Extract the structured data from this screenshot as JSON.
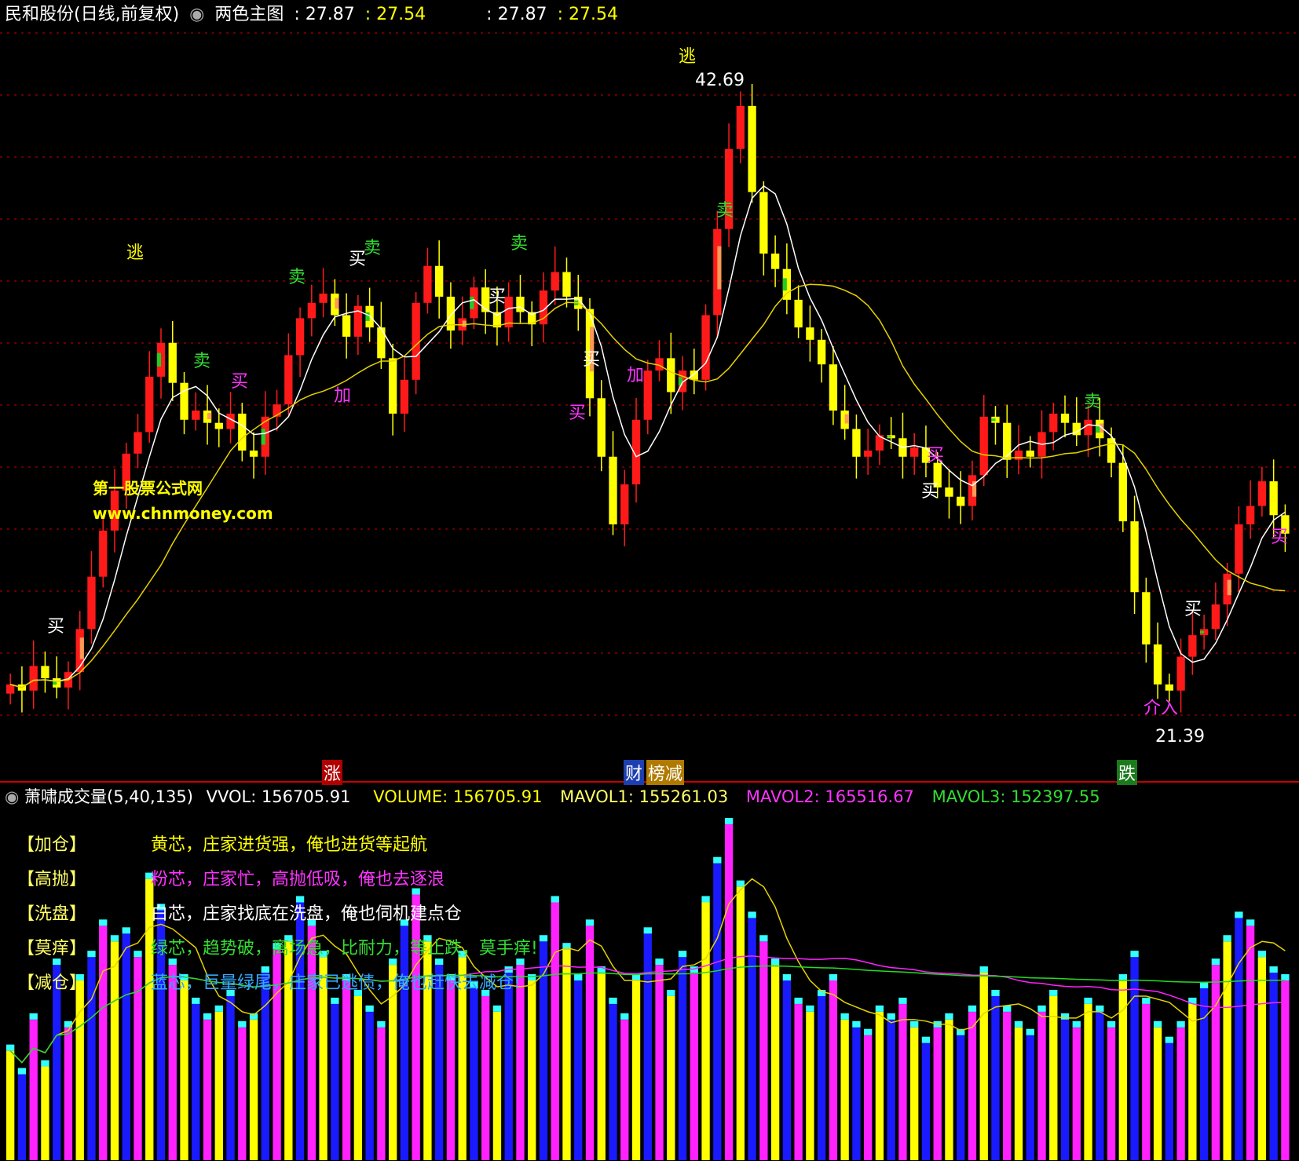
{
  "header": {
    "title": "民和股份(日线,前复权)",
    "indicator": "两色主图",
    "v1": ": 27.87",
    "v2": ": 27.54",
    "v3": ": 27.87",
    "v4": ": 27.54"
  },
  "watermark": {
    "line1": "第一股票公式网",
    "line2": "www.chnmoney.com"
  },
  "markers": {
    "high": "42.69",
    "low": "21.39",
    "flee": "逃",
    "buy": "买",
    "sell": "卖",
    "add": "加",
    "intervene": "介入",
    "mid_a": "涨",
    "mid_b": "财",
    "mid_c": "榜减",
    "mid_d": "跌"
  },
  "volume_header": {
    "name": "萧啸成交量(5,40,135)",
    "vvol": "VVOL: 156705.91",
    "volume": "VOLUME: 156705.91",
    "mavol1": "MAVOL1: 155261.03",
    "mavol2": "MAVOL2: 165516.67",
    "mavol3": "MAVOL3: 152397.55"
  },
  "legend": [
    {
      "key": "【加仓】",
      "text": "黄芯，庄家进货强，俺也进货等起航",
      "color": "#ffff00"
    },
    {
      "key": "【高抛】",
      "text": "粉芯，庄家忙，高抛低吸，俺也去逐浪",
      "color": "#ff33ff"
    },
    {
      "key": "【洗盘】",
      "text": "白芯，庄家找底在洗盘，俺也伺机建点仓",
      "color": "#ffffff"
    },
    {
      "key": "【莫痒】",
      "text": "绿芯，趋势破，离场急，比耐力，等止跌，莫手痒!",
      "color": "#33dd33"
    },
    {
      "key": "【减仓】",
      "text": "蓝芯，巨量绿尾，庄家已逃债，俺也赶快去减仓!",
      "color": "#33aaff"
    }
  ],
  "colors": {
    "up": "#ff1a1a",
    "down": "#ffff00",
    "ma_white": "#ffffff",
    "ma_yellow": "#e6d200",
    "grid": "#c80000",
    "vol_blue": "#1a1aff",
    "vol_pink": "#ff22ff",
    "vol_cyan": "#33ffff",
    "mavol_green": "#22dd22"
  },
  "chart_data": {
    "type": "candlestick",
    "price_high": 42.69,
    "price_low": 21.39,
    "close_series": [
      23.0,
      22.8,
      23.6,
      23.2,
      22.9,
      23.4,
      24.8,
      26.5,
      28.0,
      29.3,
      30.5,
      31.2,
      33.0,
      34.1,
      32.8,
      31.6,
      31.9,
      31.5,
      31.3,
      31.8,
      30.6,
      30.4,
      31.7,
      32.1,
      33.7,
      34.9,
      35.4,
      35.7,
      35.0,
      34.3,
      35.3,
      34.6,
      33.6,
      31.8,
      32.9,
      35.4,
      36.6,
      35.6,
      34.5,
      34.9,
      35.9,
      35.1,
      34.6,
      35.6,
      35.1,
      34.7,
      35.8,
      36.4,
      35.6,
      35.2,
      32.3,
      30.4,
      28.2,
      29.5,
      31.6,
      33.2,
      33.6,
      32.5,
      33.2,
      32.9,
      35.0,
      37.8,
      40.4,
      41.8,
      39.0,
      37.0,
      36.5,
      35.5,
      34.6,
      34.2,
      33.4,
      31.9,
      31.3,
      30.4,
      30.6,
      31.1,
      31.0,
      30.4,
      30.7,
      30.2,
      29.4,
      29.1,
      28.8,
      29.8,
      31.7,
      31.5,
      30.3,
      30.6,
      30.4,
      31.2,
      31.8,
      31.5,
      31.1,
      31.6,
      31.0,
      30.2,
      28.3,
      26.0,
      24.3,
      23.0,
      22.8,
      23.9,
      24.6,
      24.8,
      25.6,
      26.6,
      28.2,
      28.8,
      29.6,
      28.5,
      27.9
    ],
    "volume_series": [
      140,
      110,
      180,
      120,
      250,
      170,
      230,
      260,
      300,
      280,
      290,
      260,
      360,
      320,
      250,
      230,
      200,
      180,
      190,
      210,
      170,
      180,
      240,
      270,
      280,
      330,
      300,
      260,
      200,
      230,
      210,
      190,
      170,
      250,
      300,
      340,
      280,
      250,
      230,
      260,
      220,
      210,
      190,
      240,
      250,
      230,
      280,
      330,
      270,
      230,
      300,
      240,
      200,
      180,
      230,
      290,
      250,
      210,
      260,
      240,
      330,
      380,
      430,
      350,
      310,
      280,
      250,
      230,
      200,
      190,
      210,
      230,
      180,
      170,
      160,
      190,
      180,
      200,
      170,
      150,
      170,
      180,
      160,
      190,
      240,
      210,
      190,
      170,
      160,
      190,
      210,
      180,
      170,
      200,
      190,
      170,
      230,
      260,
      200,
      170,
      150,
      170,
      200,
      220,
      250,
      280,
      310,
      300,
      260,
      240,
      230
    ],
    "mavol1": 155261.03,
    "mavol2": 165516.67,
    "mavol3": 152397.55
  }
}
